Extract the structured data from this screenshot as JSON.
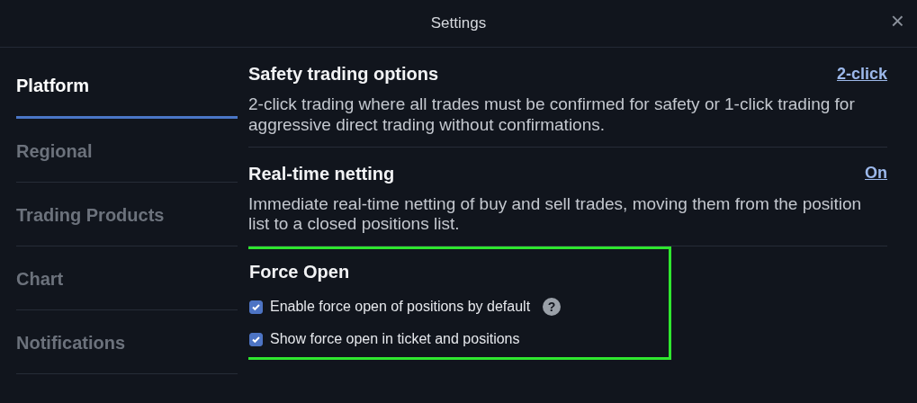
{
  "window": {
    "title": "Settings",
    "close": "×"
  },
  "sidebar": {
    "items": [
      {
        "label": "Platform",
        "selected": true
      },
      {
        "label": "Regional",
        "selected": false
      },
      {
        "label": "Trading Products",
        "selected": false
      },
      {
        "label": "Chart",
        "selected": false
      },
      {
        "label": "Notifications",
        "selected": false
      }
    ]
  },
  "sections": [
    {
      "kind": "option",
      "title": "Safety trading options",
      "value": "2-click",
      "description": "2-click trading where all trades must be confirmed for safety or 1-click trading for aggressive direct trading without confirmations.",
      "highlighted": false
    },
    {
      "kind": "option",
      "title": "Real-time netting",
      "value": "On",
      "description": "Immediate real-time netting of buy and sell trades, moving them from the position list to a closed positions list.",
      "highlighted": false
    },
    {
      "kind": "checks",
      "title": "Force Open",
      "highlighted": true,
      "checkboxes": [
        {
          "label": "Enable force open of positions by default",
          "checked": true,
          "help": "?"
        },
        {
          "label": "Show force open in ticket and positions",
          "checked": true
        }
      ]
    }
  ]
}
